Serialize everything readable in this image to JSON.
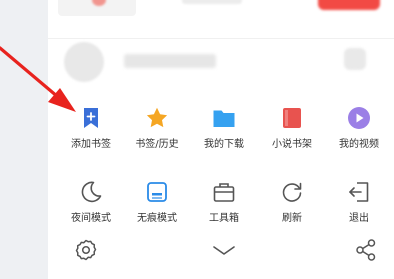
{
  "menu": {
    "row1": [
      {
        "label": "添加书签",
        "icon": "bookmark-add-icon",
        "color": "#3a6fd8"
      },
      {
        "label": "书签/历史",
        "icon": "star-icon",
        "color": "#f5a623"
      },
      {
        "label": "我的下载",
        "icon": "folder-icon",
        "color": "#35a1f0"
      },
      {
        "label": "小说书架",
        "icon": "book-icon",
        "color": "#e8534f"
      },
      {
        "label": "我的视频",
        "icon": "play-icon",
        "color": "#9b7fe6"
      }
    ],
    "row2": [
      {
        "label": "夜间模式",
        "icon": "moon-icon"
      },
      {
        "label": "无痕模式",
        "icon": "incognito-icon",
        "color": "#2a8be8"
      },
      {
        "label": "工具箱",
        "icon": "toolbox-icon"
      },
      {
        "label": "刷新",
        "icon": "refresh-icon"
      },
      {
        "label": "退出",
        "icon": "exit-icon"
      }
    ]
  },
  "bottom_bar": {
    "settings_icon": "gear-icon",
    "collapse_icon": "chevron-down-icon",
    "share_icon": "share-icon"
  },
  "colors": {
    "arrow": "#e8231e",
    "text": "#333333",
    "icon_gray": "#555555"
  }
}
